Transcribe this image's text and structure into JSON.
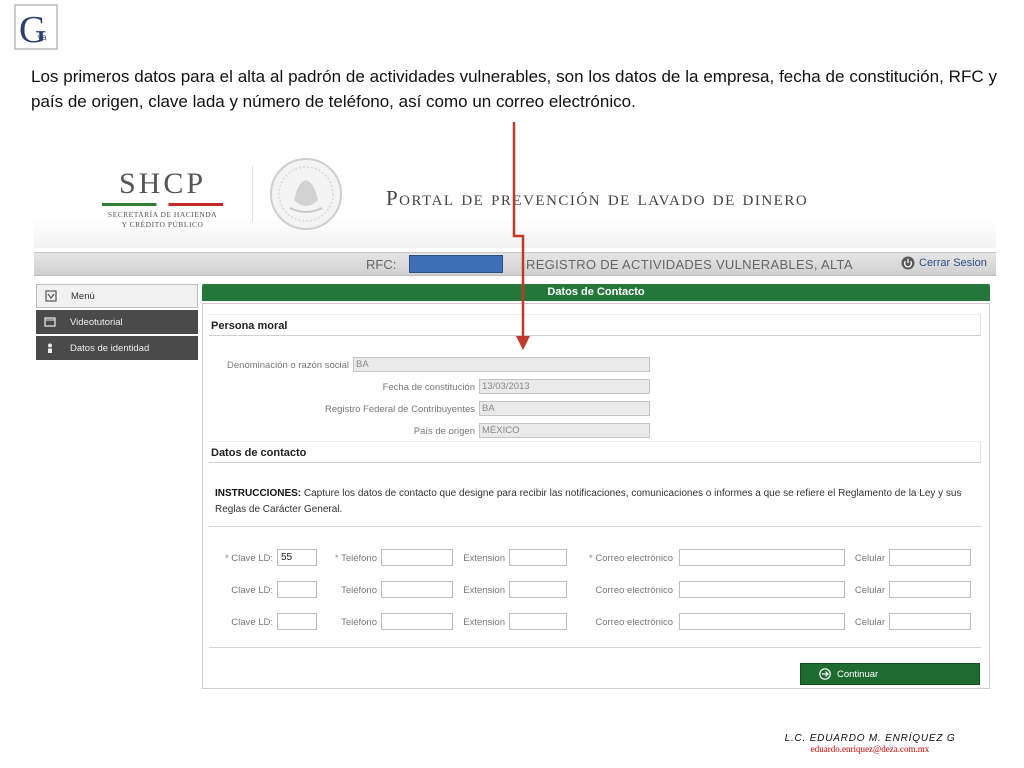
{
  "slide": {
    "logo_text": "G",
    "logo_sub": "va",
    "intro": "Los primeros datos para el alta al padrón de actividades vulnerables, son los datos de la empresa, fecha de constitución, RFC y país de origen, clave lada y número de teléfono, así como un correo electrónico.",
    "footer_name": "L.C. EDUARDO M. ENRÍQUEZ G",
    "footer_email": "eduardo.enriquez@deza.com.mx"
  },
  "header": {
    "acronym": "SHCP",
    "sub_line1": "SECRETARÍA DE HACIENDA",
    "sub_line2": "Y CRÉDITO PÚBLICO",
    "portal_title": "Portal de prevención de lavado de dinero"
  },
  "info_bar": {
    "rfc_label": "RFC:",
    "title": "REGISTRO DE ACTIVIDADES VULNERABLES, ALTA",
    "logout": "Cerrar Sesion",
    "rfc_color": "#3b6fb6"
  },
  "sidebar": {
    "items": [
      {
        "label": "Menú",
        "icon": "menu-icon"
      },
      {
        "label": "Videotutorial",
        "icon": "video-icon"
      },
      {
        "label": "Datos de identidad",
        "icon": "id-icon"
      }
    ]
  },
  "panel": {
    "title": "Datos de Contacto",
    "accent": "#26783a",
    "persona_moral": {
      "heading": "Persona moral",
      "fields": [
        {
          "label": "Denominación o razón social",
          "value": "BA"
        },
        {
          "label": "Fecha de constitución",
          "value": "13/03/2013"
        },
        {
          "label": "Registro Federal de Contribuyentes",
          "value": "BA"
        },
        {
          "label": "País de origen",
          "value": "MÉXICO"
        }
      ]
    },
    "contacto": {
      "heading": "Datos de contacto",
      "instr_bold": "INSTRUCCIONES:",
      "instr_text": " Capture los datos de contacto que designe para recibir las notificaciones, comunicaciones o informes a que se refiere el Reglamento de la Ley y sus Reglas de Carácter General.",
      "labels": {
        "clave": "Clave LD:",
        "telefono": "Teléfono",
        "extension": "Extension",
        "correo": "Correo electrónico",
        "celular": "Celular",
        "required_mark": "*"
      },
      "rows": [
        {
          "clave": "55",
          "telefono": "",
          "extension": "",
          "correo": "",
          "celular": ""
        },
        {
          "clave": "",
          "telefono": "",
          "extension": "",
          "correo": "",
          "celular": ""
        },
        {
          "clave": "",
          "telefono": "",
          "extension": "",
          "correo": "",
          "celular": ""
        }
      ]
    },
    "continue_label": "Continuar"
  }
}
